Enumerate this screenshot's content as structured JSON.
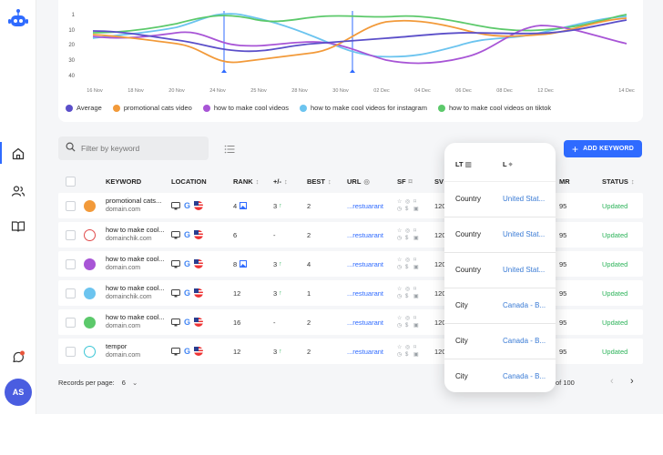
{
  "sidebar": {
    "avatar_initials": "AS",
    "items": [
      {
        "icon": "home-icon"
      },
      {
        "icon": "users-icon"
      },
      {
        "icon": "book-icon"
      }
    ],
    "accent": "#2f6bff"
  },
  "chart": {
    "y_ticks": [
      "1",
      "10",
      "20",
      "30",
      "40"
    ],
    "x_ticks": [
      "16 Nov",
      "18 Nov",
      "20 Nov",
      "24 Nov",
      "25 Nov",
      "28 Nov",
      "30 Nov",
      "02 Dec",
      "04 Dec",
      "06 Dec",
      "08 Dec",
      "12 Dec",
      "14 Dec"
    ],
    "legend": [
      {
        "label": "Average",
        "color": "#5b4fc9"
      },
      {
        "label": "promotional cats video",
        "color": "#f29a3a"
      },
      {
        "label": "how to make cool videos",
        "color": "#a855d6"
      },
      {
        "label": "how to make cool videos for instagram",
        "color": "#6cc4ef"
      },
      {
        "label": "how to make cool videos on tiktok",
        "color": "#5cc96b"
      }
    ]
  },
  "toolbar": {
    "search_placeholder": "Filter by keyword",
    "add_keyword_label": "ADD KEYWORD"
  },
  "table": {
    "headers": {
      "keyword": "KEYWORD",
      "location": "LOCATION",
      "rank": "RANK",
      "change": "+/-",
      "best": "BEST",
      "url": "URL",
      "sf": "SF",
      "sv": "SV",
      "mr": "MR",
      "status": "STATUS"
    },
    "rows": [
      {
        "keyword": "promotional cats...",
        "domain": "domain.com",
        "color": "#f29a3a",
        "style": "filled",
        "rank": "4",
        "rank_img": true,
        "change": "3",
        "change_up": true,
        "best": "2",
        "url": "...restuarant",
        "sv": "120",
        "mr": "95",
        "status": "Updated"
      },
      {
        "keyword": "how to make cool...",
        "domain": "domainchik.com",
        "color": "#e04b4b",
        "style": "outline",
        "rank": "6",
        "rank_img": false,
        "change": "-",
        "change_up": false,
        "best": "2",
        "url": "...restuarant",
        "sv": "120",
        "mr": "95",
        "status": "Updated"
      },
      {
        "keyword": "how to make cool...",
        "domain": "domain.com",
        "color": "#a855d6",
        "style": "filled",
        "rank": "8",
        "rank_img": true,
        "change": "3",
        "change_up": true,
        "best": "4",
        "url": "...restuarant",
        "sv": "120",
        "mr": "95",
        "status": "Updated"
      },
      {
        "keyword": "how to make cool...",
        "domain": "domainchik.com",
        "color": "#6cc4ef",
        "style": "filled",
        "rank": "12",
        "rank_img": false,
        "change": "3",
        "change_up": true,
        "best": "1",
        "url": "...restuarant",
        "sv": "120",
        "mr": "95",
        "status": "Updated"
      },
      {
        "keyword": "how to make cool...",
        "domain": "domain.com",
        "color": "#5cc96b",
        "style": "filled",
        "rank": "16",
        "rank_img": false,
        "change": "-",
        "change_up": false,
        "best": "2",
        "url": "...restuarant",
        "sv": "120",
        "mr": "95",
        "status": "Updated"
      },
      {
        "keyword": "tempor",
        "domain": "domain.com",
        "color": "#3cc6d6",
        "style": "outline",
        "rank": "12",
        "rank_img": false,
        "change": "3",
        "change_up": true,
        "best": "2",
        "url": "...restuarant",
        "sv": "120",
        "mr": "95",
        "status": "Updated"
      }
    ]
  },
  "pagination": {
    "records_label": "Records per page:",
    "records_value": "6",
    "range_text": "of 100"
  },
  "popup": {
    "col_lt": "LT",
    "col_l": "L",
    "rows": [
      {
        "type": "Country",
        "value": "United Stat..."
      },
      {
        "type": "Country",
        "value": "United Stat..."
      },
      {
        "type": "Country",
        "value": "United Stat..."
      },
      {
        "type": "City",
        "value": "Canada - B..."
      },
      {
        "type": "City",
        "value": "Canada - B..."
      },
      {
        "type": "City",
        "value": "Canada - B..."
      }
    ]
  }
}
